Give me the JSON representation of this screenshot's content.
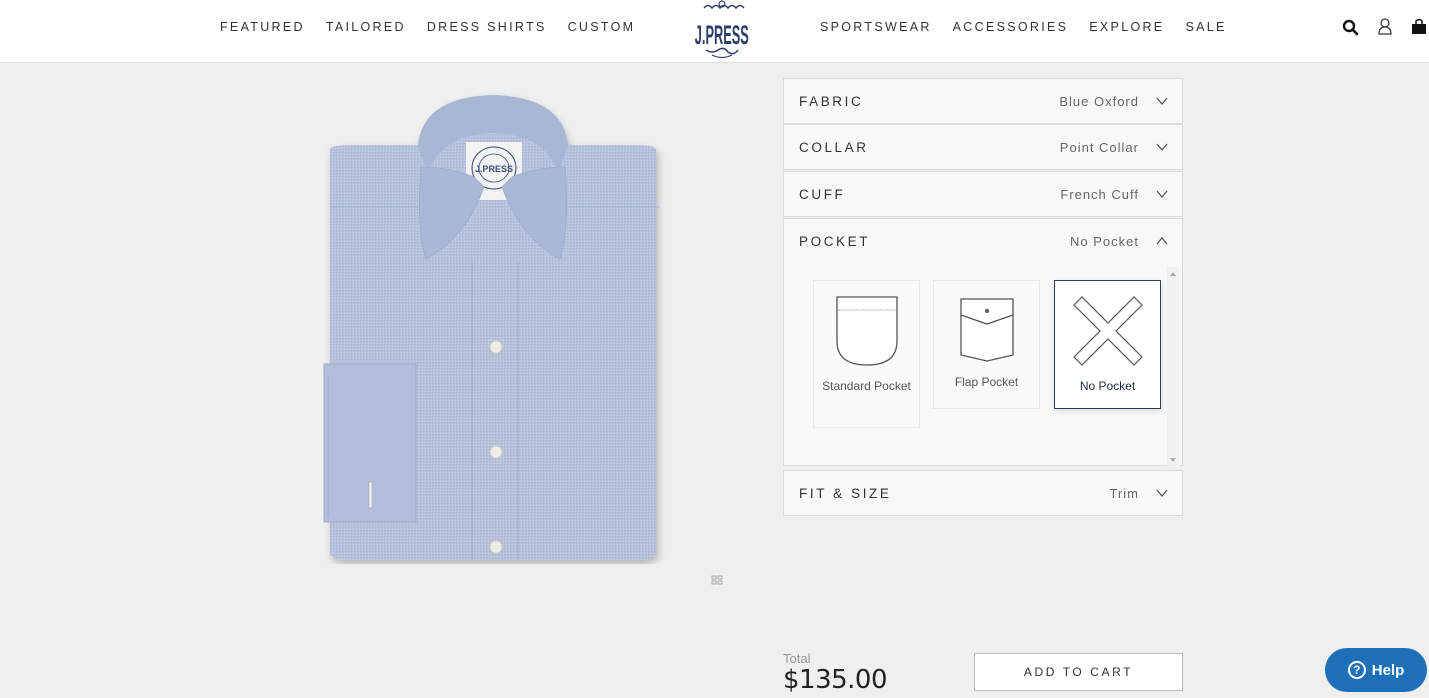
{
  "header": {
    "nav_left": [
      "FEATURED",
      "TAILORED",
      "DRESS SHIRTS",
      "CUSTOM"
    ],
    "nav_right": [
      "SPORTSWEAR",
      "ACCESSORIES",
      "EXPLORE",
      "SALE"
    ],
    "logo_text": "J.PRESS",
    "icons": [
      "search-icon",
      "account-icon",
      "shopping-bag-icon"
    ]
  },
  "product": {
    "image_alt": "Blue Oxford dress shirt with point collar and French cuff"
  },
  "configurator": {
    "sections": [
      {
        "title": "FABRIC",
        "value": "Blue Oxford",
        "expanded": false
      },
      {
        "title": "COLLAR",
        "value": "Point Collar",
        "expanded": false
      },
      {
        "title": "CUFF",
        "value": "French Cuff",
        "expanded": false
      },
      {
        "title": "POCKET",
        "value": "No Pocket",
        "expanded": true
      },
      {
        "title": "FIT & SIZE",
        "value": "Trim",
        "expanded": false
      }
    ],
    "pocket_options": [
      {
        "label": "Standard Pocket",
        "selected": false
      },
      {
        "label": "Flap Pocket",
        "selected": false
      },
      {
        "label": "No Pocket",
        "selected": true
      }
    ]
  },
  "footer": {
    "total_label": "Total",
    "total_value": "$135.00",
    "add_to_cart": "ADD TO CART",
    "help": "Help"
  },
  "colors": {
    "brand_navy": "#1f2a44",
    "help_blue": "#1d6fb8",
    "page_bg": "#efefef"
  }
}
